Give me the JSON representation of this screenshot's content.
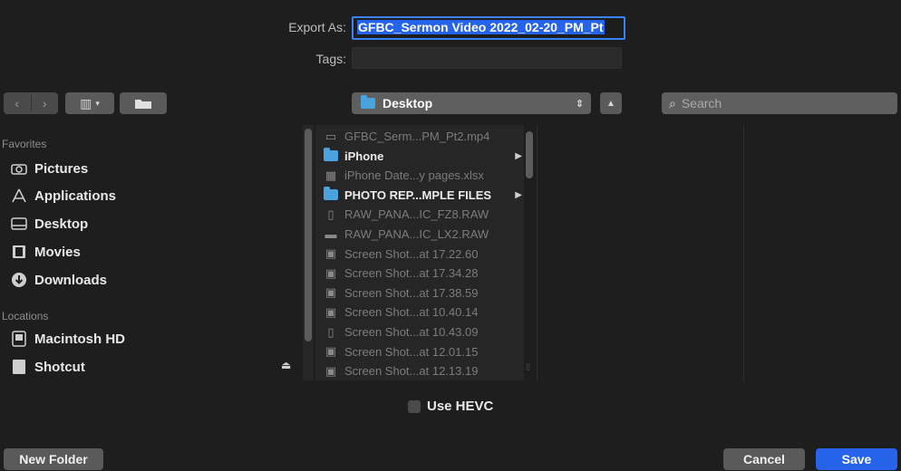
{
  "export": {
    "label": "Export As:",
    "value": "GFBC_Sermon Video 2022_02-20_PM_Pt"
  },
  "tags": {
    "label": "Tags:",
    "value": ""
  },
  "toolbar": {
    "view_label": "▥",
    "location": "Desktop",
    "search_placeholder": "Search"
  },
  "sidebar": {
    "favorites_header": "Favorites",
    "favorites": [
      {
        "label": "Pictures",
        "icon": "camera-icon"
      },
      {
        "label": "Applications",
        "icon": "applications-icon"
      },
      {
        "label": "Desktop",
        "icon": "desktop-icon"
      },
      {
        "label": "Movies",
        "icon": "film-icon"
      },
      {
        "label": "Downloads",
        "icon": "download-icon"
      }
    ],
    "locations_header": "Locations",
    "locations": [
      {
        "label": "Macintosh HD",
        "icon": "hard-drive-icon"
      },
      {
        "label": "Shotcut",
        "icon": "disk-icon"
      }
    ]
  },
  "files": [
    {
      "name": "GFBC_Serm...PM_Pt2.mp4",
      "icon": "video-file-icon",
      "bright": false,
      "folder": false
    },
    {
      "name": "iPhone",
      "icon": "folder-icon",
      "bright": true,
      "folder": true
    },
    {
      "name": "iPhone Date...y pages.xlsx",
      "icon": "spreadsheet-icon",
      "bright": false,
      "folder": false
    },
    {
      "name": "PHOTO REP...MPLE FILES",
      "icon": "folder-icon",
      "bright": true,
      "folder": true
    },
    {
      "name": "RAW_PANA...IC_FZ8.RAW",
      "icon": "document-icon",
      "bright": false,
      "folder": false
    },
    {
      "name": "RAW_PANA...IC_LX2.RAW",
      "icon": "image-file-icon",
      "bright": false,
      "folder": false
    },
    {
      "name": "Screen Shot...at 17.22.60",
      "icon": "screenshot-icon",
      "bright": false,
      "folder": false
    },
    {
      "name": "Screen Shot...at 17.34.28",
      "icon": "screenshot-icon",
      "bright": false,
      "folder": false
    },
    {
      "name": "Screen Shot...at 17.38.59",
      "icon": "screenshot-icon",
      "bright": false,
      "folder": false
    },
    {
      "name": "Screen Shot...at 10.40.14",
      "icon": "screenshot-icon",
      "bright": false,
      "folder": false
    },
    {
      "name": "Screen Shot...at 10.43.09",
      "icon": "phone-screenshot-icon",
      "bright": false,
      "folder": false
    },
    {
      "name": "Screen Shot...at 12.01.15",
      "icon": "screenshot-icon",
      "bright": false,
      "folder": false
    },
    {
      "name": "Screen Shot...at 12.13.19",
      "icon": "screenshot-icon",
      "bright": false,
      "folder": false
    }
  ],
  "options": {
    "hevc_label": "Use HEVC"
  },
  "buttons": {
    "new_folder": "New Folder",
    "cancel": "Cancel",
    "save": "Save"
  },
  "colors": {
    "accent": "#2563eb",
    "folder": "#4aa3df",
    "background": "#1e1e1e"
  }
}
